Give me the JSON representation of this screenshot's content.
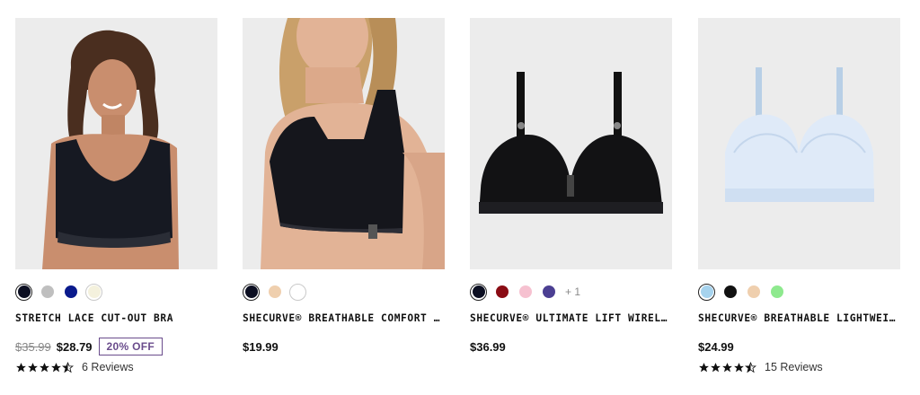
{
  "products": [
    {
      "title": "STRETCH LACE CUT-OUT BRA",
      "image": "model-black-lace-crop-bra",
      "swatches": [
        {
          "color": "#0c0f22",
          "selected": true
        },
        {
          "color": "#bfbfbf"
        },
        {
          "color": "#0a1a8c"
        },
        {
          "color": "#f4f1dd"
        }
      ],
      "more": "",
      "original_price": "$35.99",
      "price": "$28.79",
      "discount": "20% OFF",
      "rating": 4.5,
      "reviews": "6 Reviews"
    },
    {
      "title": "SHECURVE® BREATHABLE COMFORT PUSH-UP BRA",
      "image": "model-black-lace-trim-bra",
      "swatches": [
        {
          "color": "#0c0f22",
          "selected": true
        },
        {
          "color": "#efcfae"
        },
        {
          "color": "#ffffff"
        }
      ],
      "more": "",
      "original_price": "",
      "price": "$19.99",
      "discount": "",
      "rating": null,
      "reviews": ""
    },
    {
      "title": "SHECURVE® ULTIMATE LIFT WIRELESS BRA",
      "image": "black-mesh-wireless-bra",
      "swatches": [
        {
          "color": "#0c0f22",
          "selected": true
        },
        {
          "color": "#8a0c14"
        },
        {
          "color": "#f6c1d0"
        },
        {
          "color": "#4b3f92"
        }
      ],
      "more": "+ 1",
      "original_price": "",
      "price": "$36.99",
      "discount": "",
      "rating": null,
      "reviews": ""
    },
    {
      "title": "SHECURVE® BREATHABLE LIGHTWEIGHT BRA",
      "image": "light-blue-lightweight-bra",
      "swatches": [
        {
          "color": "#a6d3ee",
          "selected": true
        },
        {
          "color": "#111111"
        },
        {
          "color": "#efcfae"
        },
        {
          "color": "#8ee98e"
        }
      ],
      "more": "",
      "original_price": "",
      "price": "$24.99",
      "discount": "",
      "rating": 4.5,
      "reviews": "15 Reviews"
    }
  ]
}
